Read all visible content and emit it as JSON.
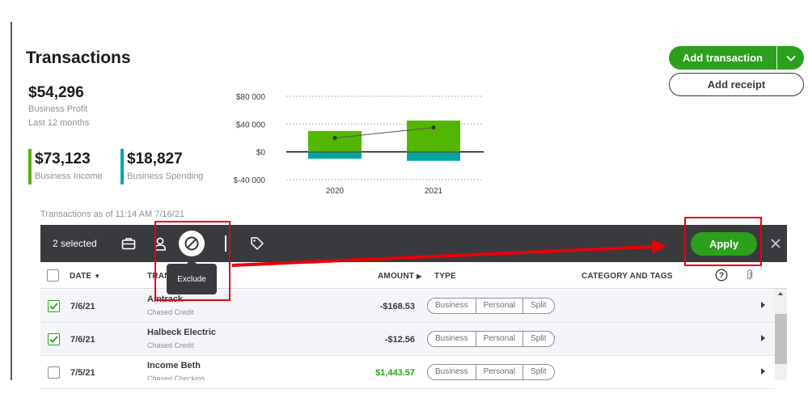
{
  "page": {
    "title": "Transactions"
  },
  "actions": {
    "add_transaction": "Add transaction",
    "add_receipt": "Add receipt"
  },
  "summary": {
    "profit": {
      "value": "$54,296",
      "label": "Business Profit",
      "period": "Last 12 months"
    },
    "income": {
      "value": "$73,123",
      "label": "Business Income",
      "color": "#53b700"
    },
    "spending": {
      "value": "$18,827",
      "label": "Business Spending",
      "color": "#00a6a4"
    }
  },
  "chart_data": {
    "type": "bar",
    "categories": [
      "2020",
      "2021"
    ],
    "series": [
      {
        "values": [
          30000,
          45000
        ],
        "color": "#53b700"
      },
      {
        "values": [
          -10000,
          -13000
        ],
        "color": "#00a6a4"
      },
      {
        "values": [
          20000,
          35000
        ],
        "color": "#555555"
      }
    ],
    "yticks": [
      "$80 000",
      "$40 000",
      "$0",
      "$-40 000"
    ],
    "ylim": [
      -40000,
      80000
    ],
    "grid": true
  },
  "as_of": "Transactions as of 11:14 AM 7/16/21",
  "toolbar": {
    "selected": "2 selected",
    "icons": [
      "briefcase-icon",
      "person-icon",
      "exclude-icon",
      "tag-icon"
    ],
    "tooltip": "Exclude",
    "apply": "Apply"
  },
  "table": {
    "headers": {
      "date": "DATE",
      "transaction": "TRAN",
      "amount": "AMOUNT",
      "type": "TYPE",
      "category": "CATEGORY AND TAGS"
    },
    "type_options": [
      "Business",
      "Personal",
      "Split"
    ],
    "rows": [
      {
        "checked": true,
        "date": "7/6/21",
        "payee": "Amtrack",
        "account": "Chased Credit",
        "amount": "-$168.53",
        "positive": false
      },
      {
        "checked": true,
        "date": "7/6/21",
        "payee": "Halbeck Electric",
        "account": "Chased Credit",
        "amount": "-$12.56",
        "positive": false
      },
      {
        "checked": false,
        "date": "7/5/21",
        "payee": "Income Beth",
        "account": "Chased Checking",
        "amount": "$1,443.57",
        "positive": true
      }
    ]
  },
  "colors": {
    "brand_green": "#2ca01c",
    "toolbar_bg": "#393a3d",
    "annotation_red": "#e8000b"
  }
}
